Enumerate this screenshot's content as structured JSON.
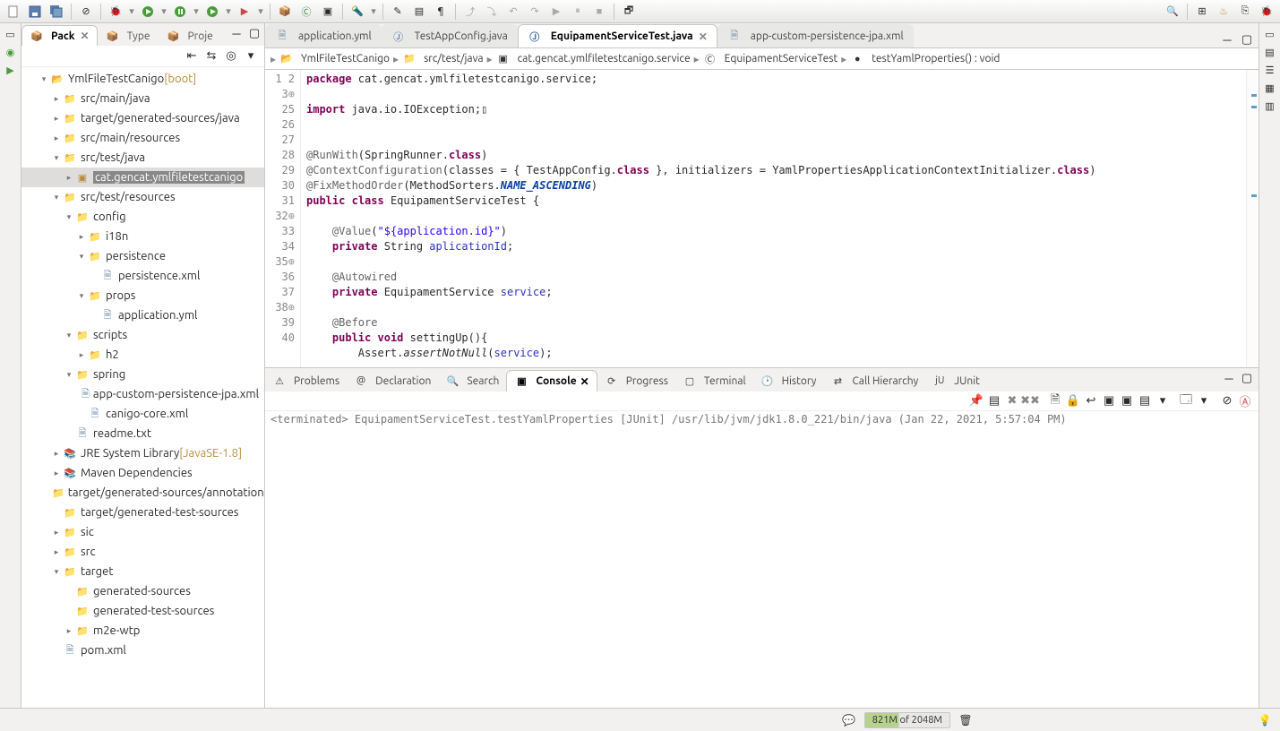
{
  "toolbar": {},
  "leftViews": {
    "tabs": [
      {
        "label": "Pack",
        "active": true,
        "closable": true
      },
      {
        "label": "Type",
        "active": false
      },
      {
        "label": "Proje",
        "active": false
      }
    ]
  },
  "tree": [
    {
      "d": 1,
      "exp": "open",
      "icon": "proj",
      "label": "YmlFileTestCanigo",
      "decor": " [boot]"
    },
    {
      "d": 2,
      "exp": "closed",
      "icon": "pkg",
      "label": "src/main/java"
    },
    {
      "d": 2,
      "exp": "closed",
      "icon": "pkg",
      "label": "target/generated-sources/java"
    },
    {
      "d": 2,
      "exp": "closed",
      "icon": "pkg",
      "label": "src/main/resources"
    },
    {
      "d": 2,
      "exp": "open",
      "icon": "pkg",
      "label": "src/test/java"
    },
    {
      "d": 3,
      "exp": "closed",
      "icon": "pkgleaf",
      "label": "cat.gencat.ymlfiletestcanigo",
      "selected": true
    },
    {
      "d": 2,
      "exp": "open",
      "icon": "pkg",
      "label": "src/test/resources"
    },
    {
      "d": 3,
      "exp": "open",
      "icon": "folder",
      "label": "config"
    },
    {
      "d": 4,
      "exp": "closed",
      "icon": "folder",
      "label": "i18n"
    },
    {
      "d": 4,
      "exp": "open",
      "icon": "folder",
      "label": "persistence"
    },
    {
      "d": 5,
      "exp": "none",
      "icon": "file",
      "label": "persistence.xml"
    },
    {
      "d": 4,
      "exp": "open",
      "icon": "folder",
      "label": "props"
    },
    {
      "d": 5,
      "exp": "none",
      "icon": "file",
      "label": "application.yml"
    },
    {
      "d": 3,
      "exp": "open",
      "icon": "folder",
      "label": "scripts"
    },
    {
      "d": 4,
      "exp": "closed",
      "icon": "folder",
      "label": "h2"
    },
    {
      "d": 3,
      "exp": "open",
      "icon": "folder",
      "label": "spring"
    },
    {
      "d": 4,
      "exp": "none",
      "icon": "file",
      "label": "app-custom-persistence-jpa.xml"
    },
    {
      "d": 4,
      "exp": "none",
      "icon": "file",
      "label": "canigo-core.xml"
    },
    {
      "d": 3,
      "exp": "none",
      "icon": "file",
      "label": "readme.txt"
    },
    {
      "d": 2,
      "exp": "closed",
      "icon": "jar",
      "label": "JRE System Library",
      "decor": " [JavaSE-1.8]"
    },
    {
      "d": 2,
      "exp": "closed",
      "icon": "jar",
      "label": "Maven Dependencies"
    },
    {
      "d": 2,
      "exp": "none",
      "icon": "folder",
      "label": "target/generated-sources/annotations"
    },
    {
      "d": 2,
      "exp": "none",
      "icon": "folder",
      "label": "target/generated-test-sources"
    },
    {
      "d": 2,
      "exp": "closed",
      "icon": "folder",
      "label": "sic"
    },
    {
      "d": 2,
      "exp": "closed",
      "icon": "folder",
      "label": "src"
    },
    {
      "d": 2,
      "exp": "open",
      "icon": "folder",
      "label": "target"
    },
    {
      "d": 3,
      "exp": "none",
      "icon": "folder",
      "label": "generated-sources"
    },
    {
      "d": 3,
      "exp": "none",
      "icon": "folder",
      "label": "generated-test-sources"
    },
    {
      "d": 3,
      "exp": "closed",
      "icon": "folder",
      "label": "m2e-wtp"
    },
    {
      "d": 2,
      "exp": "none",
      "icon": "file",
      "label": "pom.xml"
    }
  ],
  "editorTabs": [
    {
      "label": "application.yml",
      "icon": "file"
    },
    {
      "label": "TestAppConfig.java",
      "icon": "java"
    },
    {
      "label": "EquipamentServiceTest.java",
      "icon": "java",
      "active": true,
      "closable": true
    },
    {
      "label": "app-custom-persistence-jpa.xml",
      "icon": "file"
    }
  ],
  "breadcrumb": [
    {
      "icon": "proj",
      "label": "YmlFileTestCanigo"
    },
    {
      "icon": "pkg",
      "label": "src/test/java"
    },
    {
      "icon": "pkgleaf",
      "label": "cat.gencat.ymlfiletestcanigo.service"
    },
    {
      "icon": "class",
      "label": "EquipamentServiceTest"
    },
    {
      "icon": "method",
      "label": "testYamlProperties() : void"
    }
  ],
  "code": {
    "lines": [
      {
        "n": 1,
        "html": "<span class='kw'>package</span> cat.gencat.ymlfiletestcanigo.service;"
      },
      {
        "n": 2,
        "html": ""
      },
      {
        "n": 3,
        "fold": true,
        "html": "<span class='kw'>import</span> java.io.IOException;▯"
      },
      {
        "n": 25,
        "html": ""
      },
      {
        "n": 26,
        "html": ""
      },
      {
        "n": 27,
        "html": "<span class='ann'>@RunWith</span>(SpringRunner.<span class='kw'>class</span>)"
      },
      {
        "n": 28,
        "html": "<span class='ann'>@ContextConfiguration</span>(classes = { TestAppConfig.<span class='kw'>class</span> }, initializers = YamlPropertiesApplicationContextInitializer.<span class='kw'>class</span>)"
      },
      {
        "n": 29,
        "html": "<span class='ann'>@FixMethodOrder</span>(MethodSorters.<span class='stc'>NAME_ASCENDING</span>)"
      },
      {
        "n": 30,
        "html": "<span class='kw'>public</span> <span class='kw'>class</span> EquipamentServiceTest {"
      },
      {
        "n": 31,
        "html": ""
      },
      {
        "n": 32,
        "fold": true,
        "html": "    <span class='ann'>@Value</span>(<span class='str'>\"${application.id}\"</span>)"
      },
      {
        "n": 33,
        "html": "    <span class='kw'>private</span> String <span class='fld'>aplicationId</span>;"
      },
      {
        "n": 34,
        "html": ""
      },
      {
        "n": 35,
        "fold": true,
        "html": "    <span class='ann'>@Autowired</span>"
      },
      {
        "n": 36,
        "html": "    <span class='kw'>private</span> EquipamentService <span class='fld'>service</span>;"
      },
      {
        "n": 37,
        "html": ""
      },
      {
        "n": 38,
        "fold": true,
        "html": "    <span class='ann'>@Before</span>"
      },
      {
        "n": 39,
        "html": "    <span class='kw'>public</span> <span class='kw'>void</span> settingUp(){"
      },
      {
        "n": 40,
        "html": "        Assert.<span class='mtd'>assertNotNull</span>(<span class='fld'>service</span>);"
      }
    ]
  },
  "bottomTabs": [
    {
      "label": "Problems",
      "icon": "⚠"
    },
    {
      "label": "Declaration",
      "icon": "@"
    },
    {
      "label": "Search",
      "icon": "🔍"
    },
    {
      "label": "Console",
      "icon": "▣",
      "active": true,
      "closable": true
    },
    {
      "label": "Progress",
      "icon": "⟳"
    },
    {
      "label": "Terminal",
      "icon": "▢"
    },
    {
      "label": "History",
      "icon": "🕑"
    },
    {
      "label": "Call Hierarchy",
      "icon": "⇄"
    },
    {
      "label": "JUnit",
      "icon": "jU"
    }
  ],
  "console": {
    "status": "<terminated> EquipamentServiceTest.testYamlProperties [JUnit] /usr/lib/jvm/jdk1.8.0_221/bin/java (Jan 22, 2021, 5:57:04 PM)"
  },
  "statusBar": {
    "heap": "821M of 2048M"
  }
}
